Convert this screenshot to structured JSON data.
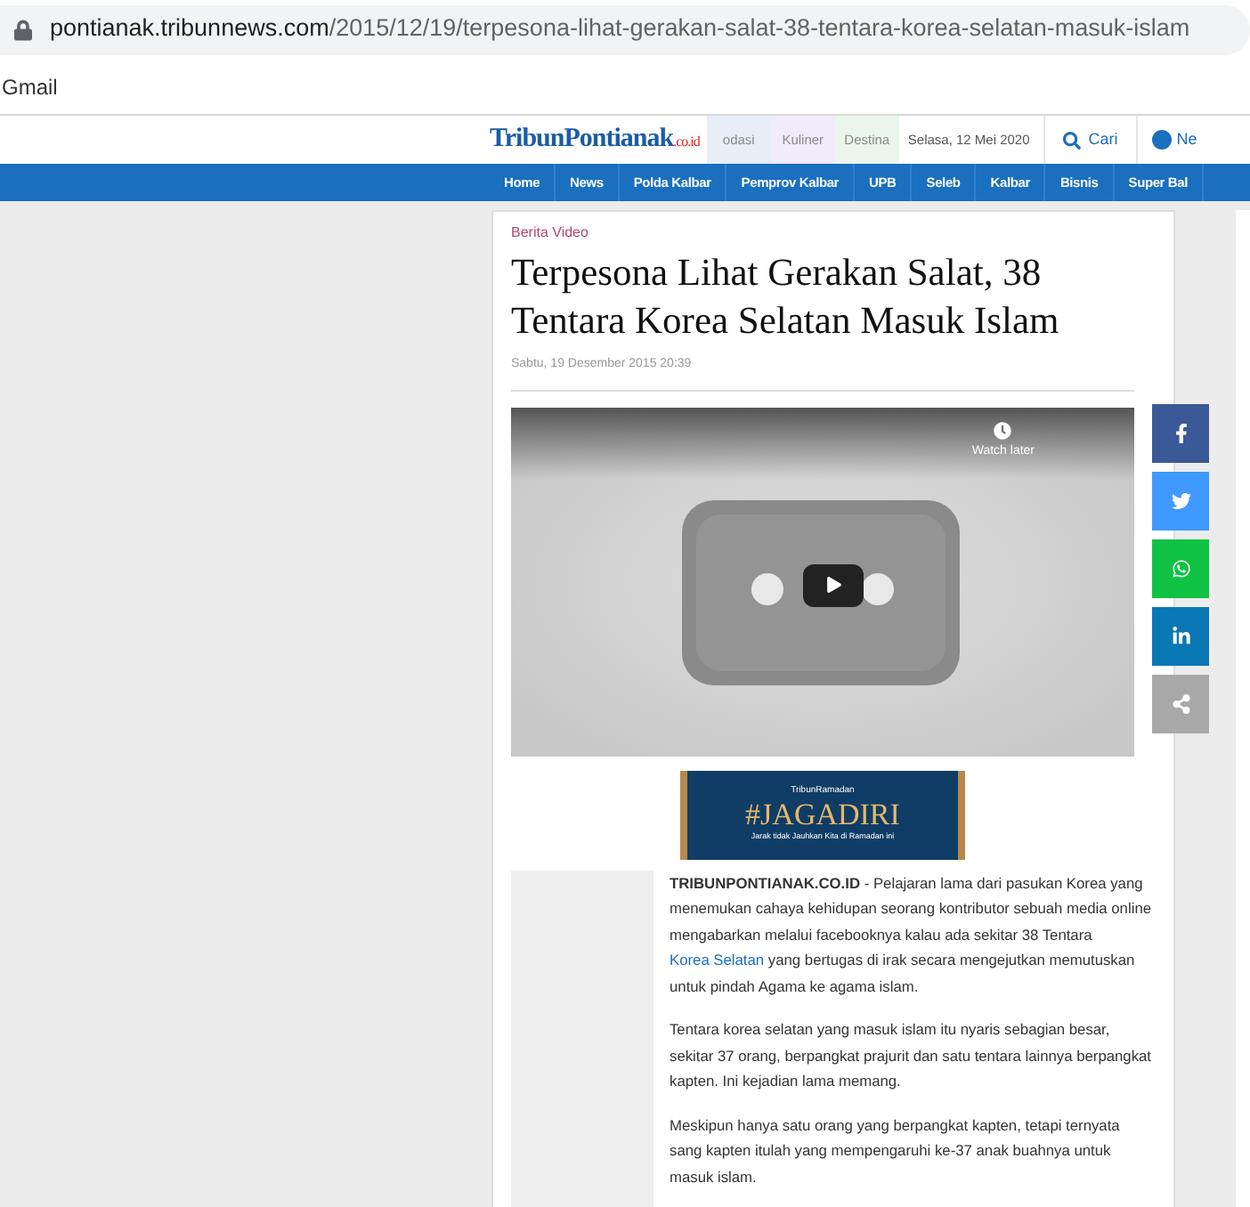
{
  "browser": {
    "url_host": "pontianak.tribunnews.com",
    "url_path": "/2015/12/19/terpesona-lihat-gerakan-salat-38-tentara-korea-selatan-masuk-islam",
    "bookmarks": [
      "Gmail"
    ]
  },
  "header": {
    "logo_main": "TribunPontianak",
    "logo_suffix": ".co.id",
    "faded_tabs": [
      {
        "label": "odasi",
        "color": "#e8eef8"
      },
      {
        "label": "Kuliner",
        "color": "#f1ecfb"
      },
      {
        "label": "Destina",
        "color": "#eaf6ec"
      }
    ],
    "date": "Selasa, 12 Mei 2020",
    "search_label": "Cari",
    "network_label": "Ne"
  },
  "nav": [
    {
      "label": "Home"
    },
    {
      "label": "News"
    },
    {
      "label": "Polda Kalbar"
    },
    {
      "label": "Pemprov Kalbar"
    },
    {
      "label": "UPB"
    },
    {
      "label": "Seleb"
    },
    {
      "label": "Kalbar"
    },
    {
      "label": "Bisnis"
    },
    {
      "label": "Super Bal"
    }
  ],
  "article": {
    "category": "Berita Video",
    "title": "Terpesona Lihat Gerakan Salat, 38 Tentara Korea Selatan Masuk Islam",
    "date": "Sabtu, 19 Desember 2015 20:39",
    "video": {
      "kind": "picture",
      "watch_later": "Watch later"
    },
    "share": [
      {
        "kind": "facebook",
        "color": "#3b5998"
      },
      {
        "kind": "twitter",
        "color": "#4099ff"
      },
      {
        "kind": "whatsapp",
        "color": "#10c243"
      },
      {
        "kind": "linkedin",
        "color": "#0a77b5"
      },
      {
        "kind": "share",
        "color": "#a8a8a8"
      }
    ],
    "banner": {
      "brand": "TribunRamadan",
      "headline": "#JAGADIRI",
      "tagline": "Jarak tidak Jauhkan Kita di Ramadan ini"
    },
    "paragraphs": [
      [
        {
          "kind": "text",
          "text": "**TRIBUNPONTIANAK.CO.ID** - Pelajaran lama dari pasukan Korea yang menemukan cahaya kehidupan seorang kontributor sebuah media online mengabarkan melalui facebooknya kalau ada sekitar 38 Tentara "
        },
        {
          "kind": "link",
          "text": "Korea Selatan"
        },
        {
          "kind": "text",
          "text": " yang bertugas di irak secara mengejutkan memutuskan untuk pindah Agama ke agama islam."
        }
      ],
      [
        {
          "kind": "text",
          "text": "Tentara korea selatan yang masuk islam itu nyaris sebagian besar, sekitar 37 orang, berpangkat prajurit dan satu tentara lainnya berpangkat kapten. Ini kejadian lama memang."
        }
      ],
      [
        {
          "kind": "text",
          "text": "Meskipun hanya satu orang yang berpangkat kapten, tetapi ternyata sang kapten itulah yang mempengaruhi ke-37 anak buahnya untuk masuk islam."
        }
      ]
    ]
  }
}
